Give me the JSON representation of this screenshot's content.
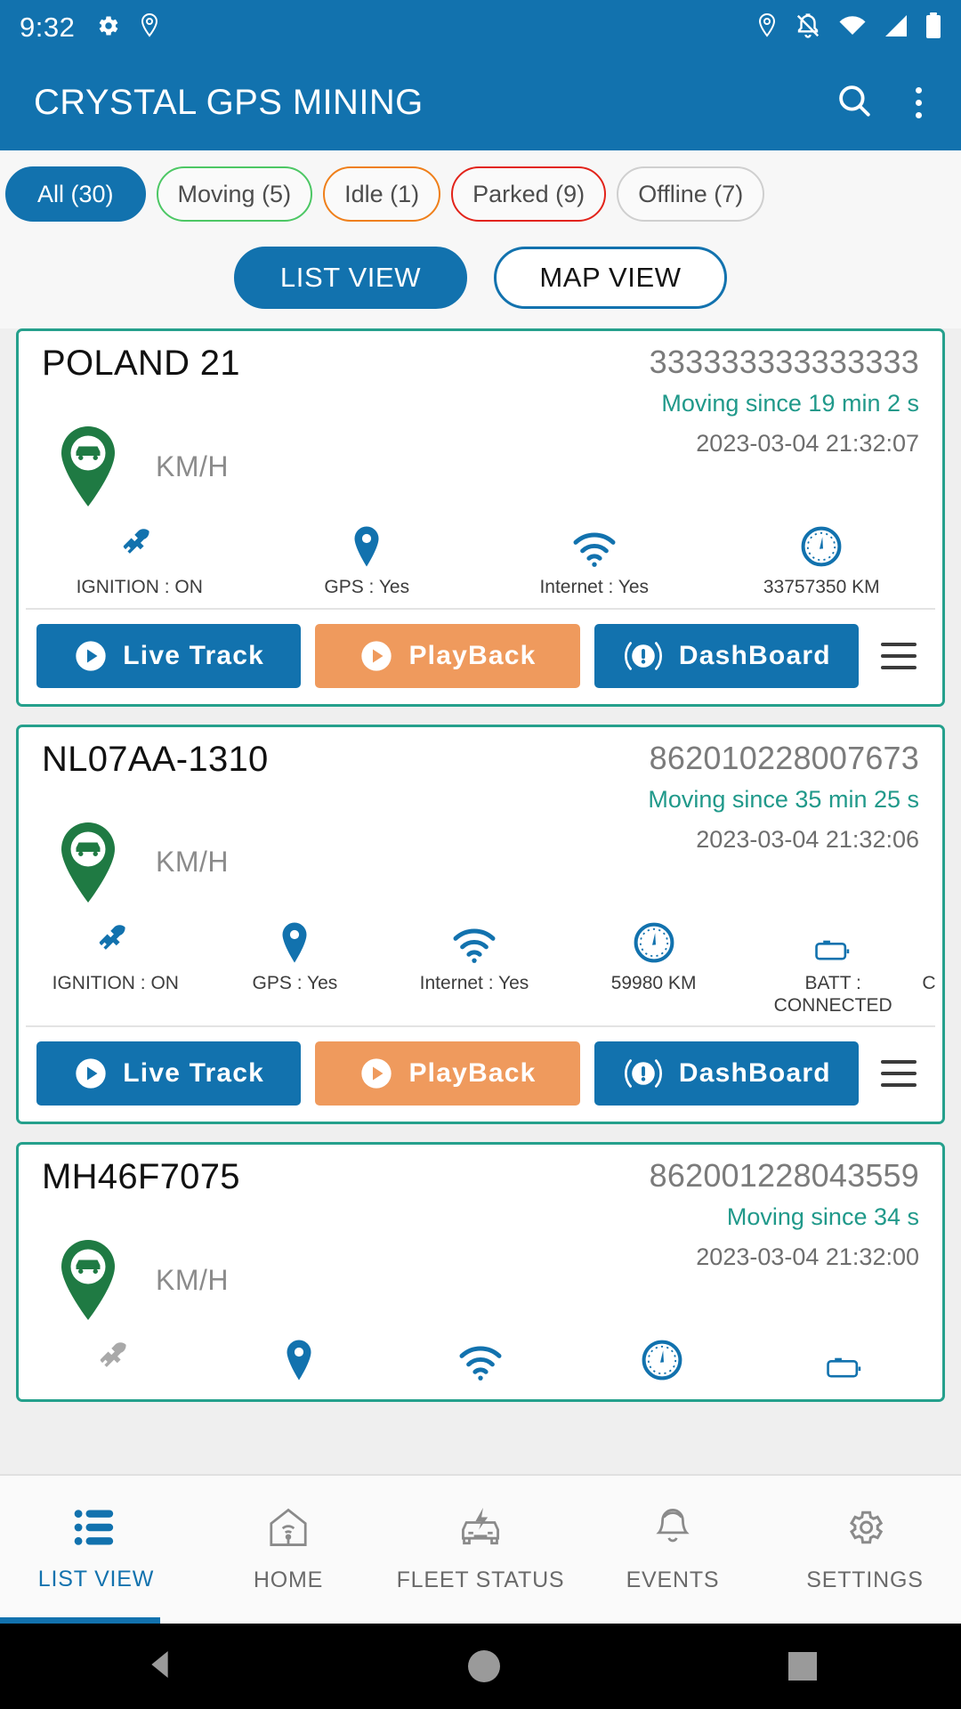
{
  "status_bar": {
    "time": "9:32",
    "left_icons": [
      "gear-icon",
      "location-pin-icon"
    ],
    "right_icons": [
      "location-pin-icon",
      "notifications-off-icon",
      "wifi-icon",
      "signal-icon",
      "battery-icon"
    ]
  },
  "app_bar": {
    "title": "CRYSTAL GPS MINING",
    "search_icon": "search-icon",
    "overflow_icon": "more-vert-icon"
  },
  "filters": {
    "chips": [
      {
        "label": "All (30)",
        "key": "all",
        "selected": true,
        "color": "#1272ae"
      },
      {
        "label": "Moving (5)",
        "key": "moving",
        "selected": false,
        "color": "#4cc764"
      },
      {
        "label": "Idle (1)",
        "key": "idle",
        "selected": false,
        "color": "#ef7f1a"
      },
      {
        "label": "Parked (9)",
        "key": "parked",
        "selected": false,
        "color": "#e2231a"
      },
      {
        "label": "Offline (7)",
        "key": "offline",
        "selected": false,
        "color": "#cfcfcf"
      }
    ]
  },
  "view_toggle": {
    "list_label": "LIST VIEW",
    "map_label": "MAP VIEW",
    "active": "LIST VIEW"
  },
  "buttons": {
    "live_track": "Live Track",
    "playback": "PlayBack",
    "dashboard": "DashBoard",
    "menu_icon": "hamburger-menu-icon"
  },
  "vehicles": [
    {
      "name": "POLAND 21",
      "imei": "333333333333333",
      "status_text": "Moving since 19 min 2 s",
      "timestamp": "2023-03-04 21:32:07",
      "speed_unit": "KM/H",
      "marker_color": "#1f7a43",
      "stats": [
        {
          "icon": "key-icon",
          "label": "IGNITION : ON"
        },
        {
          "icon": "location-pin-icon",
          "label": "GPS : Yes"
        },
        {
          "icon": "wifi-icon",
          "label": "Internet : Yes"
        },
        {
          "icon": "speedometer-icon",
          "label": "33757350 KM"
        }
      ]
    },
    {
      "name": "NL07AA-1310",
      "imei": "862010228007673",
      "status_text": "Moving since 35 min 25 s",
      "timestamp": "2023-03-04 21:32:06",
      "speed_unit": "KM/H",
      "marker_color": "#1f7a43",
      "stats": [
        {
          "icon": "key-icon",
          "label": "IGNITION : ON"
        },
        {
          "icon": "location-pin-icon",
          "label": "GPS : Yes"
        },
        {
          "icon": "wifi-icon",
          "label": "Internet : Yes"
        },
        {
          "icon": "speedometer-icon",
          "label": "59980 KM"
        },
        {
          "icon": "battery-icon",
          "label": "BATT : CONNECTED"
        },
        {
          "icon": "cut-off-icon",
          "label": "C"
        }
      ]
    },
    {
      "name": "MH46F7075",
      "imei": "862001228043559",
      "status_text": "Moving since 34 s",
      "timestamp": "2023-03-04 21:32:00",
      "speed_unit": "KM/H",
      "marker_color": "#1f7a43",
      "stats": [
        {
          "icon": "key-icon",
          "label": ""
        },
        {
          "icon": "location-pin-icon",
          "label": ""
        },
        {
          "icon": "wifi-icon",
          "label": ""
        },
        {
          "icon": "speedometer-icon",
          "label": ""
        },
        {
          "icon": "battery-icon",
          "label": ""
        }
      ]
    }
  ],
  "bottom_nav": {
    "items": [
      {
        "label": "LIST VIEW",
        "icon": "list-icon",
        "active": true
      },
      {
        "label": "HOME",
        "icon": "home-wifi-icon",
        "active": false
      },
      {
        "label": "FLEET STATUS",
        "icon": "car-bolt-icon",
        "active": false
      },
      {
        "label": "EVENTS",
        "icon": "bell-icon",
        "active": false
      },
      {
        "label": "SETTINGS",
        "icon": "gear-icon",
        "active": false
      }
    ]
  },
  "android_nav": {
    "back": "back-triangle-icon",
    "home": "home-circle-icon",
    "recents": "recents-square-icon"
  },
  "colors": {
    "primary": "#1272ae",
    "card_border": "#25a08c",
    "moving_text": "#20998a",
    "playback": "#ef9a5d"
  }
}
